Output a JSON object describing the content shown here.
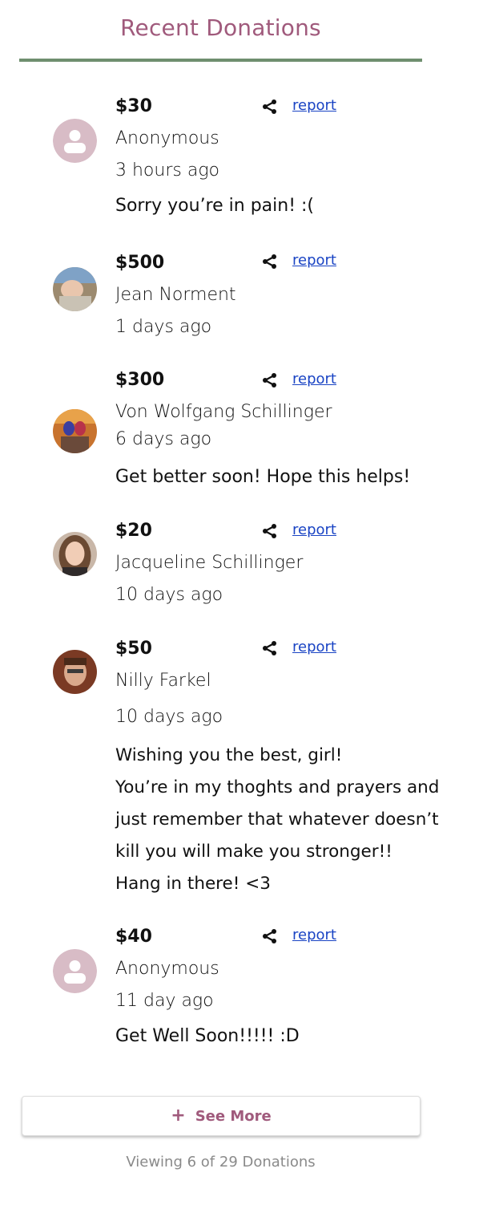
{
  "header": {
    "title": "Recent Donations"
  },
  "colors": {
    "accent": "#a05a7c",
    "rule": "#6f8f6f",
    "link": "#1a44c4",
    "placeholder_avatar": "#d8bcc6"
  },
  "donations": [
    {
      "amount": "$30",
      "name": "Anonymous",
      "time": "3 hours ago",
      "message": "Sorry you’re in pain! :(",
      "report_label": "report",
      "avatar": "placeholder"
    },
    {
      "amount": "$500",
      "name": "Jean Norment",
      "time": "1 days ago",
      "message": "",
      "report_label": "report",
      "avatar": "photo-baby"
    },
    {
      "amount": "$300",
      "name": "Von Wolfgang Schillinger",
      "time": "6 days ago",
      "message": "Get better soon! Hope this helps!",
      "report_label": "report",
      "avatar": "photo-couple"
    },
    {
      "amount": "$20",
      "name": "Jacqueline Schillinger",
      "time": "10 days ago",
      "message": "",
      "report_label": "report",
      "avatar": "photo-woman"
    },
    {
      "amount": "$50",
      "name": "Nilly Farkel",
      "time": "10 days ago",
      "message": "Wishing you the best, girl!\nYou’re in my thoghts and prayers and\njust remember that whatever doesn’t\nkill you will make you  stronger!!\nHang in there! <3",
      "report_label": "report",
      "avatar": "photo-man"
    },
    {
      "amount": "$40",
      "name": "Anonymous",
      "time": "11 day ago",
      "message": "Get Well Soon!!!!! :D",
      "report_label": "report",
      "avatar": "placeholder"
    }
  ],
  "see_more": {
    "label": "See More",
    "icon": "plus-icon"
  },
  "footer": {
    "text": "Viewing 6 of 29 Donations"
  }
}
